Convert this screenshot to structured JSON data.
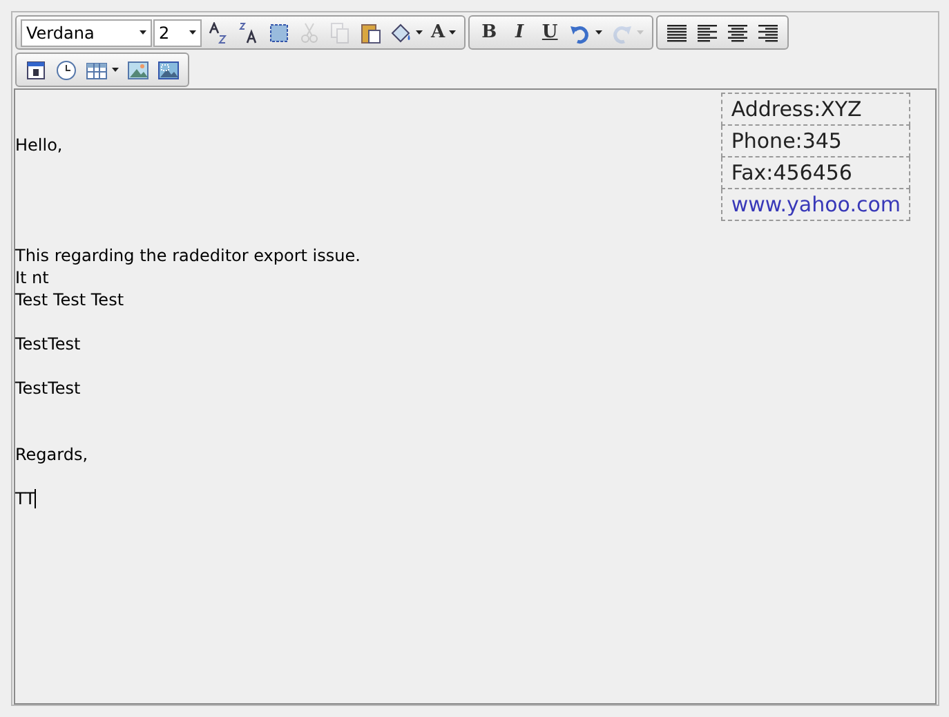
{
  "toolbar_rows": [
    {
      "groups": [
        {
          "tools": [
            {
              "kind": "select",
              "value": "Verdana"
            },
            {
              "kind": "select",
              "value": "2"
            },
            {
              "kind": "superscript-a"
            },
            {
              "kind": "subscript-a"
            },
            {
              "kind": "select-all"
            },
            {
              "kind": "cut",
              "disabled": true
            },
            {
              "kind": "copy",
              "disabled": true
            },
            {
              "kind": "paste"
            },
            {
              "kind": "fill",
              "dropdown": true
            },
            {
              "kind": "letter",
              "label": "A",
              "dropdown": true
            }
          ]
        },
        {
          "tools": [
            {
              "kind": "letter",
              "label": "B"
            },
            {
              "kind": "letter",
              "label": "I",
              "italic": true
            },
            {
              "kind": "letter",
              "label": "U",
              "underline": true
            },
            {
              "kind": "undo",
              "dropdown": true
            },
            {
              "kind": "redo",
              "dropdown": true,
              "disabled": true
            }
          ]
        },
        {
          "tools": [
            {
              "kind": "justify"
            },
            {
              "kind": "align-left"
            },
            {
              "kind": "align-center"
            },
            {
              "kind": "align-right"
            }
          ]
        }
      ]
    },
    {
      "groups": [
        {
          "tools": [
            {
              "kind": "calendar"
            },
            {
              "kind": "clock"
            },
            {
              "kind": "table",
              "dropdown": true
            },
            {
              "kind": "image"
            },
            {
              "kind": "image-map"
            }
          ]
        }
      ]
    }
  ],
  "contact_table": [
    {
      "text": "Address:XYZ",
      "kind": "text"
    },
    {
      "text": "Phone:345",
      "kind": "text"
    },
    {
      "text": "Fax:456456",
      "kind": "text"
    },
    {
      "text": "www.yahoo.com",
      "kind": "link"
    }
  ],
  "paragraphs": [
    {
      "kind": "blank"
    },
    {
      "kind": "blank"
    },
    {
      "kind": "text",
      "text": "Hello,"
    },
    {
      "kind": "blank"
    },
    {
      "kind": "blank"
    },
    {
      "kind": "blank"
    },
    {
      "kind": "blank"
    },
    {
      "kind": "text",
      "text": "This regarding the radeditor export issue."
    },
    {
      "kind": "text",
      "text": "It nt"
    },
    {
      "kind": "text",
      "text": "Test Test Test"
    },
    {
      "kind": "blank"
    },
    {
      "kind": "text",
      "text": "TestTest"
    },
    {
      "kind": "blank"
    },
    {
      "kind": "text",
      "text": "TestTest"
    },
    {
      "kind": "blank"
    },
    {
      "kind": "blank"
    },
    {
      "kind": "text",
      "text": "Regards,"
    },
    {
      "kind": "blank"
    },
    {
      "kind": "text",
      "text": "TT",
      "cursor": true
    }
  ]
}
